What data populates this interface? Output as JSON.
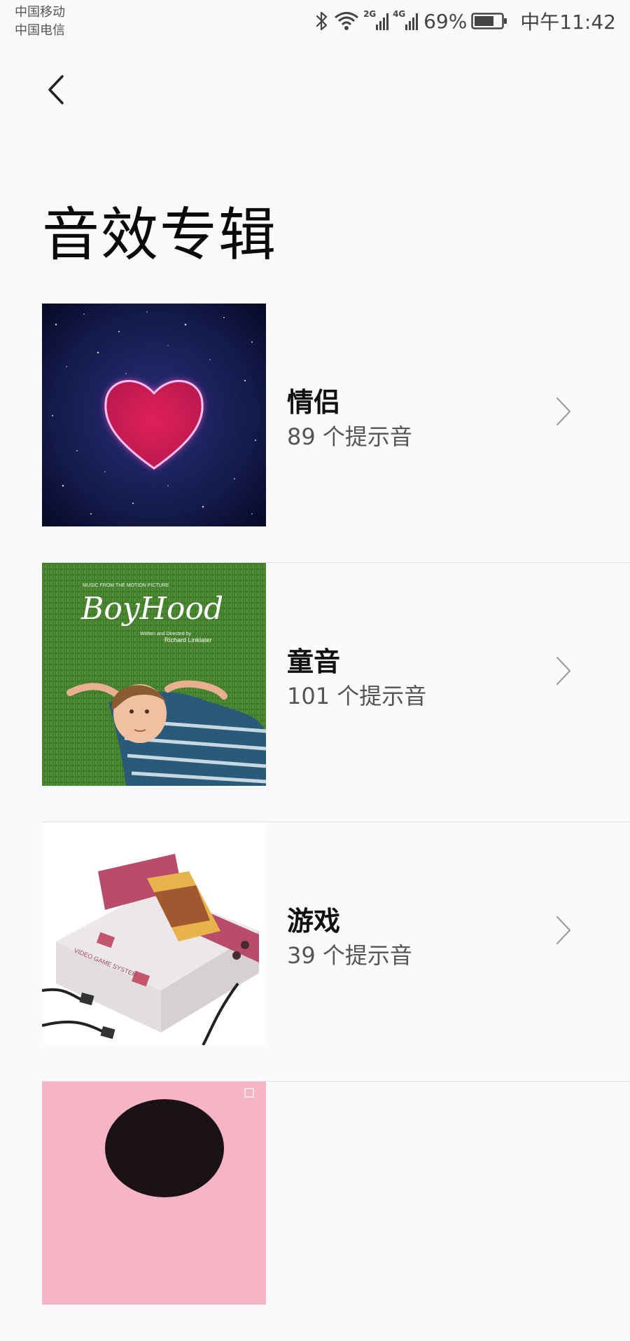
{
  "status_bar": {
    "carrier_1": "中国移动",
    "carrier_2": "中国电信",
    "signal_1_tag": "2G",
    "signal_2_tag": "4G",
    "battery_percent": "69%",
    "time": "中午11:42",
    "icons": [
      "bluetooth-icon",
      "wifi-icon",
      "signal-icon",
      "signal-icon",
      "battery-icon"
    ]
  },
  "header": {
    "back_icon": "back-arrow-icon",
    "title": "音效专辑"
  },
  "albums": [
    {
      "name": "情侣",
      "count": "89 个提示音",
      "cover": "heart-galaxy-cover"
    },
    {
      "name": "童音",
      "count": "101 个提示音",
      "cover": "boyhood-cover",
      "cover_text": {
        "top": "MUSIC FROM THE MOTION PICTURE",
        "title": "BoyHood",
        "credit_1": "Written and Directed by",
        "credit_2": "Richard Linklater"
      }
    },
    {
      "name": "游戏",
      "count": "39 个提示音",
      "cover": "game-console-cover",
      "cover_text": {
        "system": "VIDEO GAME SYSTEM"
      }
    },
    {
      "name": "",
      "count": "",
      "cover": "pink-portrait-cover"
    }
  ],
  "colors": {
    "background": "#fafafc",
    "divider": "#e2e2e4",
    "text_primary": "#111111",
    "text_secondary": "#555555"
  }
}
